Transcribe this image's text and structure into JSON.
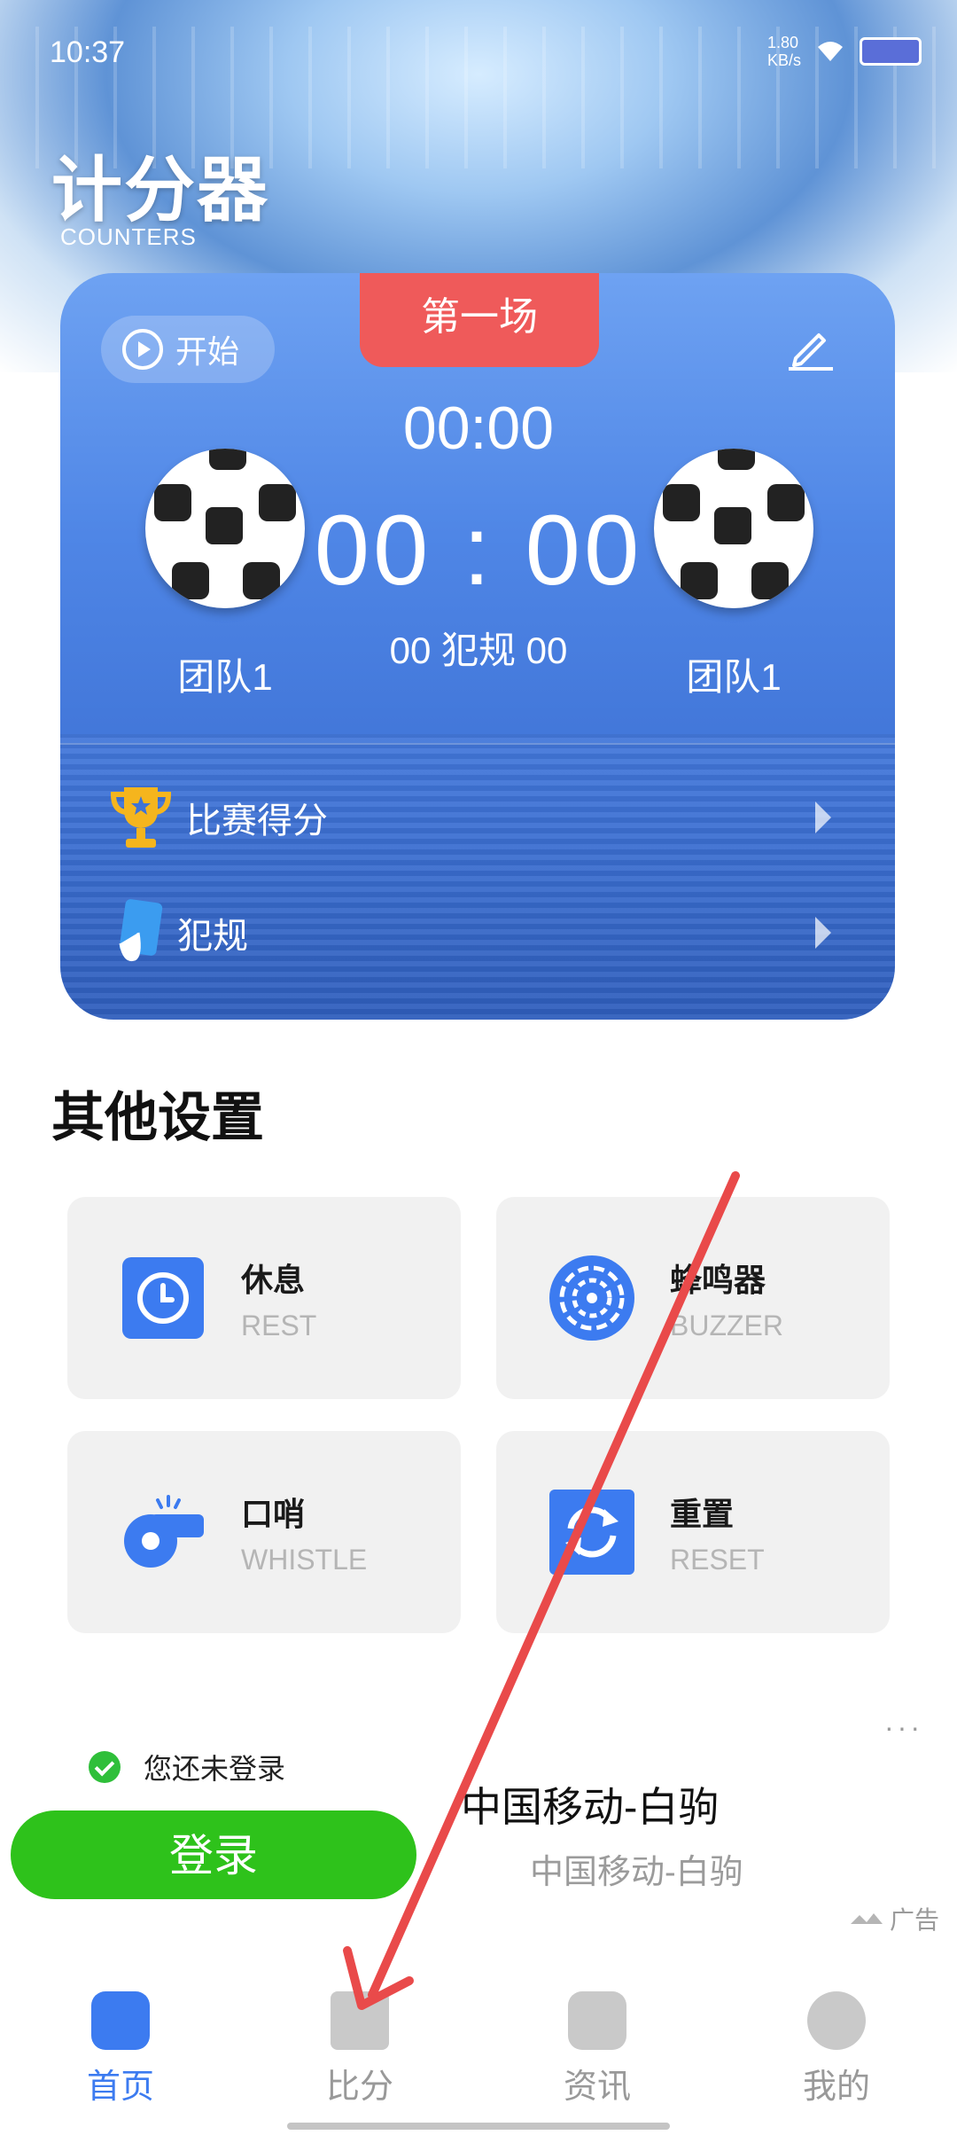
{
  "status_bar": {
    "time": "10:37",
    "net_speed": "1.80\nKB/s"
  },
  "header": {
    "title": "计分器",
    "subtitle": "COUNTERS"
  },
  "scoreboard": {
    "match_label": "第一场",
    "start_label": "开始",
    "timer": "00:00",
    "score": "00 : 00",
    "fouls_text": "00  犯规  00",
    "team_left": "团队1",
    "team_right": "团队1",
    "rows": [
      {
        "label": "比赛得分",
        "icon": "trophy-icon"
      },
      {
        "label": "犯规",
        "icon": "foul-icon"
      }
    ]
  },
  "settings": {
    "title": "其他设置",
    "tiles": [
      {
        "name": "休息",
        "sub": "REST",
        "icon": "clock-icon"
      },
      {
        "name": "蜂鸣器",
        "sub": "BUZZER",
        "icon": "buzzer-icon"
      },
      {
        "name": "口哨",
        "sub": "WHISTLE",
        "icon": "whistle-icon"
      },
      {
        "name": "重置",
        "sub": "RESET",
        "icon": "reset-icon"
      }
    ]
  },
  "ad": {
    "more": "···",
    "login_hint": "您还未登录",
    "login_button": "登录",
    "title": "中国移动-白驹",
    "subtitle": "中国移动-白驹",
    "label": "广告"
  },
  "bottom_nav": [
    {
      "label": "首页",
      "active": true
    },
    {
      "label": "比分",
      "active": false
    },
    {
      "label": "资讯",
      "active": false
    },
    {
      "label": "我的",
      "active": false
    }
  ],
  "colors": {
    "accent": "#3c7bf0",
    "match_tag": "#ef5a5a",
    "login_green": "#2ec21b",
    "annotation_arrow": "#e94a4a"
  }
}
